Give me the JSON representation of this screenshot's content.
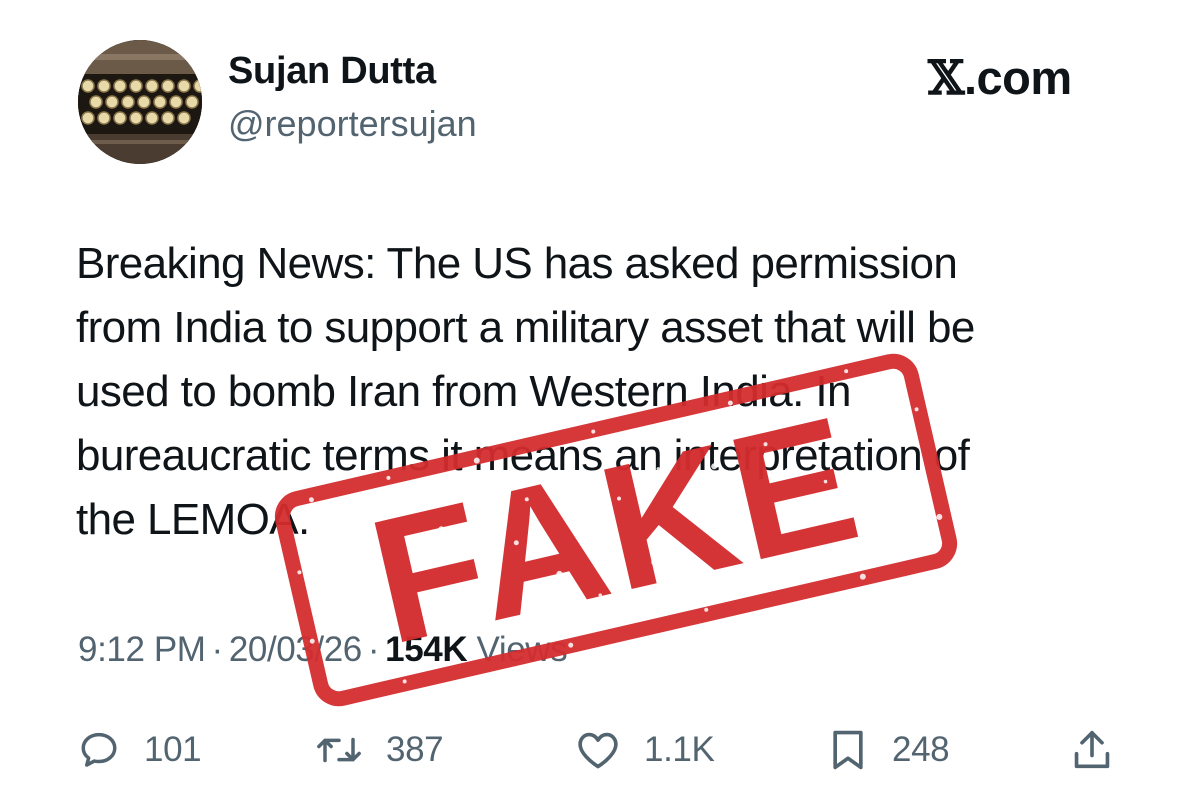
{
  "tweet": {
    "author": {
      "display_name": "Sujan Dutta",
      "handle": "@reportersujan",
      "avatar": "typewriter-avatar"
    },
    "platform": {
      "mark": "𝕏",
      "domain": ".com"
    },
    "body_lines": [
      "Breaking News: The US has asked permission",
      "from India to support a military asset that will be",
      "used to bomb Iran from Western India. In",
      "bureaucratic terms it means an interpretation of",
      "the LEMOA."
    ],
    "meta": {
      "time": "9:12 PM",
      "separator": "·",
      "date": "20/03/26",
      "views_count": "154K",
      "views_label": "Views"
    },
    "actions": {
      "replies": {
        "icon": "reply-icon",
        "count": "101"
      },
      "reposts": {
        "icon": "repost-icon",
        "count": "387"
      },
      "likes": {
        "icon": "heart-icon",
        "count": "1.1K"
      },
      "bookmarks": {
        "icon": "bookmark-icon",
        "count": "248"
      },
      "share": {
        "icon": "share-icon"
      }
    }
  },
  "overlay": {
    "stamp_text": "FAKE",
    "stamp_color": "#d42c2e"
  },
  "colors": {
    "text_primary": "#0f1419",
    "text_secondary": "#536471",
    "background": "#ffffff"
  }
}
